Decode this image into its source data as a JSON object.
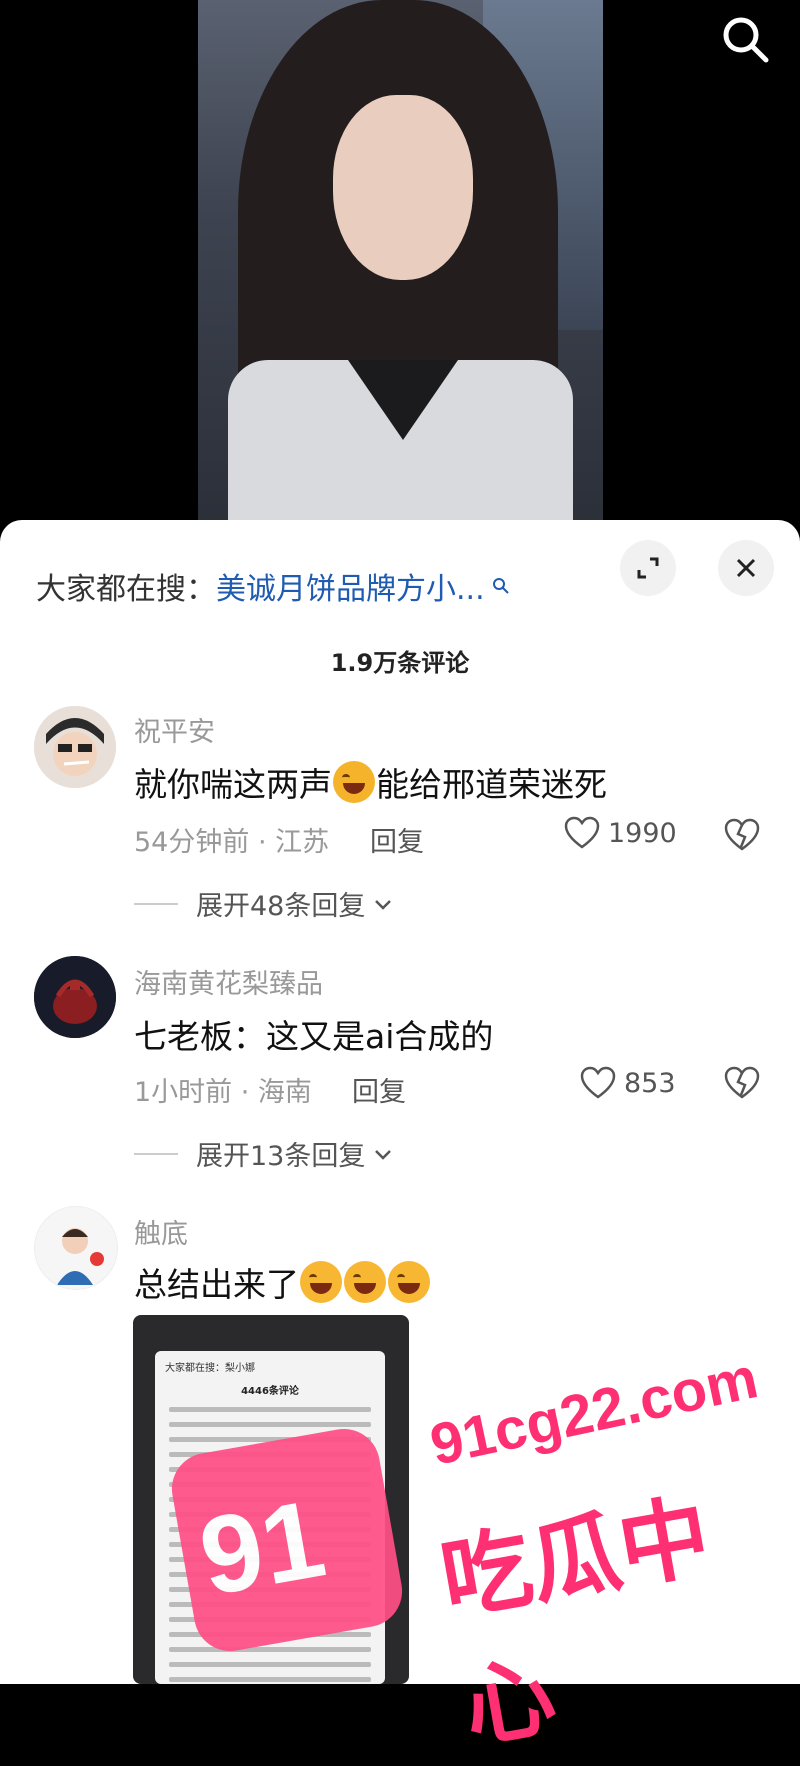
{
  "search_bar": {
    "prefix": "大家都在搜：",
    "query": "美诚月饼品牌方小..."
  },
  "comments_header": {
    "count_label": "1.9万条评论"
  },
  "comments": [
    {
      "username": "祝平安",
      "text_before": "就你喘这两声",
      "text_after": "能给邢道荣迷死",
      "meta": "54分钟前 · 江苏",
      "reply_label": "回复",
      "likes": "1990",
      "expand_label": "展开48条回复"
    },
    {
      "username": "海南黄花梨臻品",
      "text": "七老板：这又是ai合成的",
      "meta": "1小时前 · 海南",
      "reply_label": "回复",
      "likes": "853",
      "expand_label": "展开13条回复"
    },
    {
      "username": "触底",
      "text": "总结出来了",
      "emoji_count": 3
    }
  ],
  "thumbnail": {
    "mini_search": "大家都在搜：梨小娜",
    "mini_count": "4446条评论"
  },
  "watermark": {
    "url": "91cg22.com",
    "name": "吃瓜中心",
    "logo": "91"
  },
  "colors": {
    "link": "#1f5bb0",
    "watermark": "#ff2f73"
  }
}
